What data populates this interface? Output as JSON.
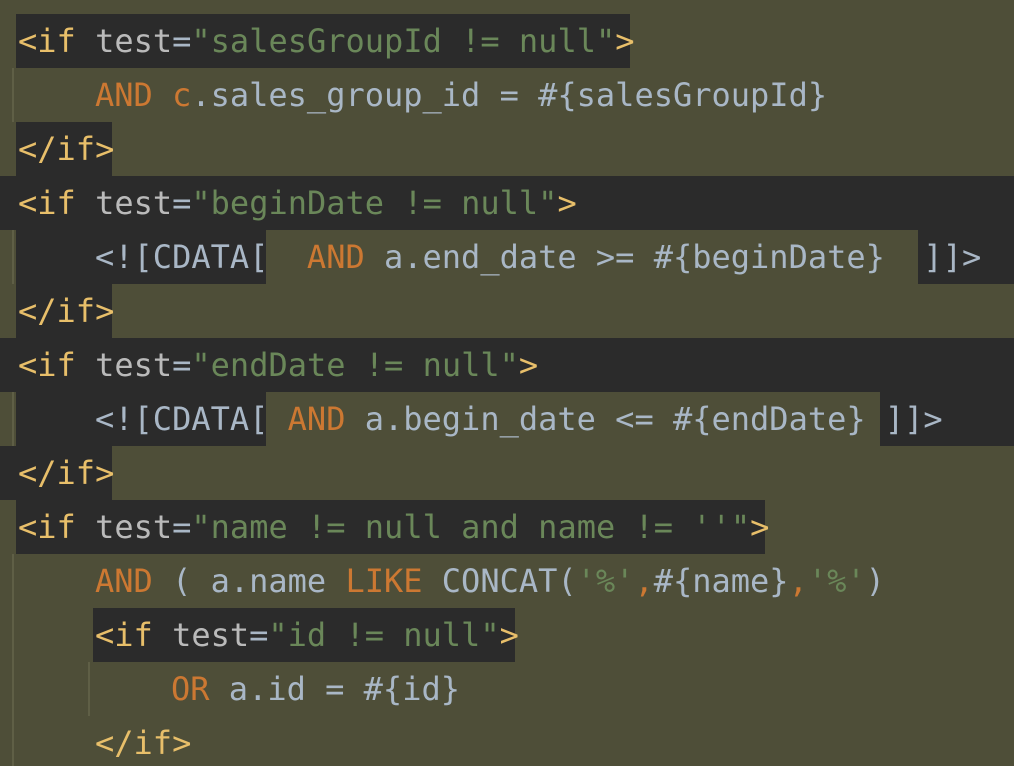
{
  "editor": {
    "lines": [
      {
        "id": "if-salesgroup-open",
        "tokens": [
          {
            "t": "<if",
            "c": "tag"
          },
          {
            "t": " test",
            "c": "attr"
          },
          {
            "t": "=",
            "c": "plain"
          },
          {
            "t": "\"salesGroupId != null\"",
            "c": "str"
          },
          {
            "t": ">",
            "c": "tag"
          }
        ]
      },
      {
        "id": "and-sales-group",
        "tokens": [
          {
            "t": "AND ",
            "c": "kw"
          },
          {
            "t": "c",
            "c": "alias"
          },
          {
            "t": ".sales_group_id = #{salesGroupId}",
            "c": "plain"
          }
        ]
      },
      {
        "id": "if-salesgroup-close",
        "tokens": [
          {
            "t": "</if>",
            "c": "tag"
          }
        ]
      },
      {
        "id": "if-begindate-open",
        "tokens": [
          {
            "t": "<if",
            "c": "tag"
          },
          {
            "t": " test",
            "c": "attr"
          },
          {
            "t": "=",
            "c": "plain"
          },
          {
            "t": "\"beginDate != null\"",
            "c": "str"
          },
          {
            "t": ">",
            "c": "tag"
          }
        ]
      },
      {
        "id": "cdata-begindate",
        "tokens": [
          {
            "t": "<![CDATA[",
            "c": "plain"
          },
          {
            "t": "  AND ",
            "c": "kw"
          },
          {
            "t": "a.end_date >= #{beginDate}  ",
            "c": "plain"
          },
          {
            "t": "]]>",
            "c": "plain"
          }
        ]
      },
      {
        "id": "if-begindate-close",
        "tokens": [
          {
            "t": "</if>",
            "c": "tag"
          }
        ]
      },
      {
        "id": "if-enddate-open",
        "tokens": [
          {
            "t": "<if",
            "c": "tag"
          },
          {
            "t": " test",
            "c": "attr"
          },
          {
            "t": "=",
            "c": "plain"
          },
          {
            "t": "\"endDate != null\"",
            "c": "str"
          },
          {
            "t": ">",
            "c": "tag"
          }
        ]
      },
      {
        "id": "cdata-enddate",
        "tokens": [
          {
            "t": "<![CDATA[",
            "c": "plain"
          },
          {
            "t": " AND ",
            "c": "kw"
          },
          {
            "t": "a.begin_date <= #{endDate} ",
            "c": "plain"
          },
          {
            "t": "]]>",
            "c": "plain"
          }
        ]
      },
      {
        "id": "if-enddate-close",
        "tokens": [
          {
            "t": "</if>",
            "c": "tag"
          }
        ]
      },
      {
        "id": "if-name-open",
        "tokens": [
          {
            "t": "<if",
            "c": "tag"
          },
          {
            "t": " test",
            "c": "attr"
          },
          {
            "t": "=",
            "c": "plain"
          },
          {
            "t": "\"name != null and name != ''\"",
            "c": "str"
          },
          {
            "t": ">",
            "c": "tag"
          }
        ]
      },
      {
        "id": "and-name-like",
        "tokens": [
          {
            "t": "AND ",
            "c": "kw"
          },
          {
            "t": "( a.name ",
            "c": "plain"
          },
          {
            "t": "LIKE ",
            "c": "kw"
          },
          {
            "t": "CONCAT(",
            "c": "plain"
          },
          {
            "t": "'%'",
            "c": "str"
          },
          {
            "t": ",",
            "c": "kw"
          },
          {
            "t": "#{name}",
            "c": "plain"
          },
          {
            "t": ",",
            "c": "kw"
          },
          {
            "t": "'%'",
            "c": "str"
          },
          {
            "t": ")",
            "c": "plain"
          }
        ]
      },
      {
        "id": "if-id-open",
        "tokens": [
          {
            "t": "<if",
            "c": "tag"
          },
          {
            "t": " test",
            "c": "attr"
          },
          {
            "t": "=",
            "c": "plain"
          },
          {
            "t": "\"id != null\"",
            "c": "str"
          },
          {
            "t": ">",
            "c": "tag"
          }
        ]
      },
      {
        "id": "or-id",
        "tokens": [
          {
            "t": "OR ",
            "c": "kw"
          },
          {
            "t": "a.id = #{id}",
            "c": "plain"
          }
        ]
      },
      {
        "id": "if-id-close",
        "tokens": [
          {
            "t": "</if>",
            "c": "tag"
          }
        ]
      }
    ]
  }
}
